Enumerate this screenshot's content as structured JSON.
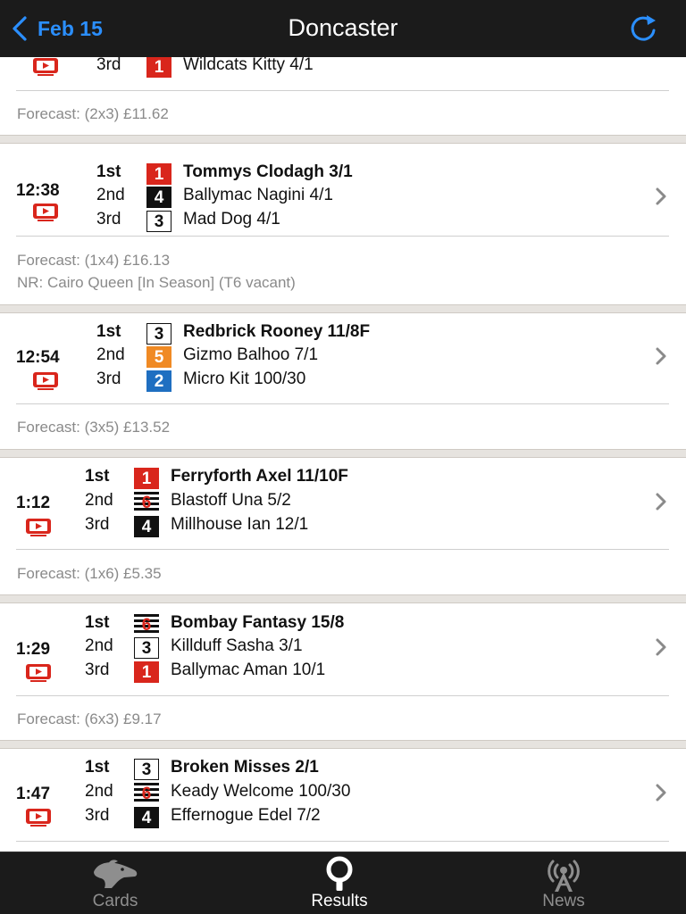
{
  "nav": {
    "back_label": "Feb 15",
    "title": "Doncaster",
    "icons": {
      "back": "chevron-left-icon",
      "refresh": "refresh-icon"
    }
  },
  "colors": {
    "accent": "#2b8fff",
    "bar": "#1b1b1b",
    "trap1": "#d9261c",
    "trap2": "#1f6fc1",
    "trap3": "#ffffff",
    "trap4": "#111111",
    "trap5": "#f08a24",
    "trap6": "black-white-stripes"
  },
  "partial_race": {
    "position": "3rd",
    "trap": "1",
    "runner": "Wildcats Kitty 4/1",
    "forecast": "Forecast: (2x3) £11.62"
  },
  "races": [
    {
      "time": "12:38",
      "results": [
        {
          "position": "1st",
          "trap": "1",
          "runner": "Tommys Clodagh 3/1"
        },
        {
          "position": "2nd",
          "trap": "4",
          "runner": "Ballymac Nagini 4/1"
        },
        {
          "position": "3rd",
          "trap": "3",
          "runner": "Mad Dog 4/1"
        }
      ],
      "forecast": "Forecast: (1x4) £16.13",
      "nr": "NR: Cairo Queen [In Season] (T6 vacant)"
    },
    {
      "time": "12:54",
      "results": [
        {
          "position": "1st",
          "trap": "3",
          "runner": "Redbrick Rooney 11/8F"
        },
        {
          "position": "2nd",
          "trap": "5",
          "runner": "Gizmo Balhoo 7/1"
        },
        {
          "position": "3rd",
          "trap": "2",
          "runner": "Micro Kit 100/30"
        }
      ],
      "forecast": "Forecast: (3x5) £13.52"
    },
    {
      "time": "1:12",
      "results": [
        {
          "position": "1st",
          "trap": "1",
          "runner": "Ferryforth Axel 11/10F"
        },
        {
          "position": "2nd",
          "trap": "6",
          "runner": "Blastoff Una 5/2"
        },
        {
          "position": "3rd",
          "trap": "4",
          "runner": "Millhouse Ian 12/1"
        }
      ],
      "forecast": "Forecast: (1x6) £5.35"
    },
    {
      "time": "1:29",
      "results": [
        {
          "position": "1st",
          "trap": "6",
          "runner": "Bombay Fantasy 15/8"
        },
        {
          "position": "2nd",
          "trap": "3",
          "runner": "Killduff Sasha 3/1"
        },
        {
          "position": "3rd",
          "trap": "1",
          "runner": "Ballymac Aman 10/1"
        }
      ],
      "forecast": "Forecast: (6x3) £9.17"
    },
    {
      "time": "1:47",
      "results": [
        {
          "position": "1st",
          "trap": "3",
          "runner": "Broken Misses 2/1"
        },
        {
          "position": "2nd",
          "trap": "6",
          "runner": "Keady Welcome 100/30"
        },
        {
          "position": "3rd",
          "trap": "4",
          "runner": "Effernogue Edel 7/2"
        }
      ]
    }
  ],
  "tabs": [
    {
      "label": "Cards",
      "icon": "greyhound-head-icon",
      "active": false
    },
    {
      "label": "Results",
      "icon": "results-magnifier-icon",
      "active": true
    },
    {
      "label": "News",
      "icon": "broadcast-tower-icon",
      "active": false
    }
  ]
}
